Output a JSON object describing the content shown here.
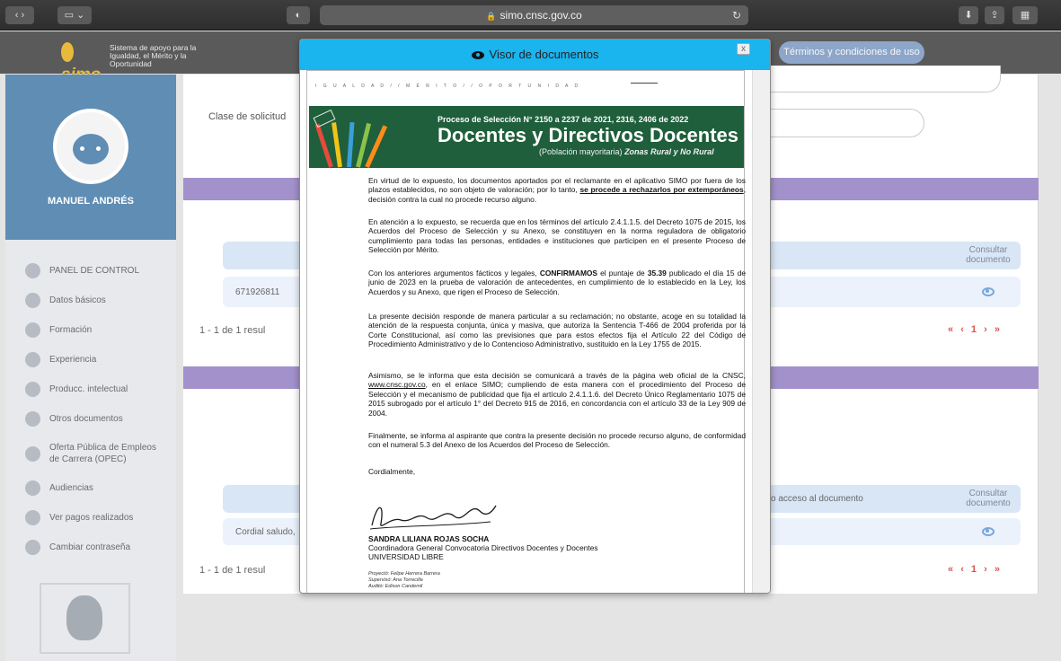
{
  "browser": {
    "url": "simo.cnsc.gov.co",
    "reload_icon": "reload-icon"
  },
  "header": {
    "logo_text": "simo",
    "tagline": "Sistema de apoyo para la Igualdad, el Mérito y la Oportunidad",
    "terms_button": "Términos y condiciones de uso"
  },
  "sidebar": {
    "user_name": "MANUEL ANDRÉS",
    "items": [
      {
        "label": "PANEL DE CONTROL",
        "icon": "dashboard-icon"
      },
      {
        "label": "Datos básicos",
        "icon": "people-icon"
      },
      {
        "label": "Formación",
        "icon": "graduation-icon"
      },
      {
        "label": "Experiencia",
        "icon": "briefcase-icon"
      },
      {
        "label": "Producc. intelectual",
        "icon": "book-icon"
      },
      {
        "label": "Otros documentos",
        "icon": "document-icon"
      },
      {
        "label": "Oferta Pública de Empleos de Carrera (OPEC)",
        "icon": "offer-icon"
      },
      {
        "label": "Audiencias",
        "icon": "audience-icon"
      },
      {
        "label": "Ver pagos realizados",
        "icon": "dollar-icon"
      },
      {
        "label": "Cambiar contraseña",
        "icon": "lock-icon"
      }
    ]
  },
  "main": {
    "clase_label": "Clase de solicitud",
    "table1": {
      "consult_header": "Consultar documento",
      "row_value": "671926811",
      "footer": "1 - 1 de 1 resul",
      "pager": [
        "«",
        "‹",
        "1",
        "›",
        "»"
      ]
    },
    "table2": {
      "access_header": "o acceso al documento",
      "consult_header": "Consultar documento",
      "row_value": "Cordial saludo,",
      "footer": "1 - 1 de 1 resul",
      "pager": [
        "«",
        "‹",
        "1",
        "›",
        "»"
      ]
    }
  },
  "modal": {
    "title": "Visor de documentos",
    "close": "x",
    "motto": "I G U A L D A D   / /   M É R I T O   / /   O P O R T U N I D A D",
    "banner_line1": "Proceso de Selección N° 2150 a 2237 de 2021, 2316, 2406 de 2022",
    "banner_line2": "Docentes  y Directivos Docentes",
    "banner_line3a": "(Población mayoritaria)",
    "banner_line3b": "Zonas Rural y No Rural",
    "p1a": "En virtud de lo expuesto, los documentos aportados por el reclamante en el aplicativo SIMO por fuera de los plazos establecidos, no son objeto de valoración; por lo tanto,",
    "p1b": "se procede a rechazarlos por extemporáneos",
    "p1c": ", decisión contra la cual no procede recurso alguno.",
    "p2": "En atención a lo expuesto, se recuerda que en los términos del artículo 2.4.1.1.5. del Decreto 1075 de 2015, los Acuerdos del Proceso de Selección y su Anexo, se constituyen en la norma reguladora de obligatorio cumplimiento para todas las personas, entidades e instituciones que participen en el presente Proceso de Selección por Mérito.",
    "p3a": "Con los anteriores argumentos fácticos y legales,",
    "p3b": "CONFIRMAMOS",
    "p3c": "el puntaje de",
    "p3d": "35.39",
    "p3e": "publicado el día 15 de junio de 2023 en la prueba de valoración de antecedentes, en cumplimiento de lo establecido en la Ley, los Acuerdos y su Anexo, que rigen el Proceso de Selección.",
    "p4": "La presente decisión responde de manera particular a su reclamación; no obstante, acoge en su totalidad la atención de la respuesta conjunta, única y masiva, que autoriza la Sentencia T-466 de 2004 proferida por la Corte Constitucional, así como las previsiones que para estos efectos fija el Artículo 22 del Código de Procedimiento Administrativo y de lo Contencioso Administrativo, sustituido en la Ley 1755 de 2015.",
    "p5a": "Asimismo, se le informa que esta decisión se comunicará a través de la página web oficial de la CNSC,",
    "p5b": "www.cnsc.gov.co",
    "p5c": ", en el enlace SIMO; cumpliendo de esta manera con el procedimiento del Proceso de Selección y el mecanismo de publicidad que fija el artículo 2.4.1.1.6. del Decreto Único Reglamentario 1075 de 2015 subrogado por el artículo 1° del Decreto 915 de 2016, en concordancia con el artículo 33 de la Ley 909 de 2004.",
    "p6": "Finalmente, se informa al aspirante que contra la presente decisión no procede recurso alguno, de conformidad con el numeral 5.3 del Anexo de los Acuerdos del Proceso de Selección.",
    "closing": "Cordialmente,",
    "signer_name": "SANDRA LILIANA ROJAS SOCHA",
    "signer_role": "Coordinadora General Convocatoria Directivos Docentes y Docentes",
    "signer_org": "UNIVERSIDAD LIBRE",
    "proyecto": "Proyectó: Felipe Herrera Barrera",
    "superviso": "Supervisó: Ana Torrecilla",
    "audito": "Auditó: Edison Candemil"
  },
  "colors": {
    "modal_header": "#1ab4ef",
    "section_bar": "#a391cc",
    "sidebar_user_bg": "#5f8db4",
    "banner_green": "#1f5f3b",
    "pager_red": "#d9534f"
  }
}
